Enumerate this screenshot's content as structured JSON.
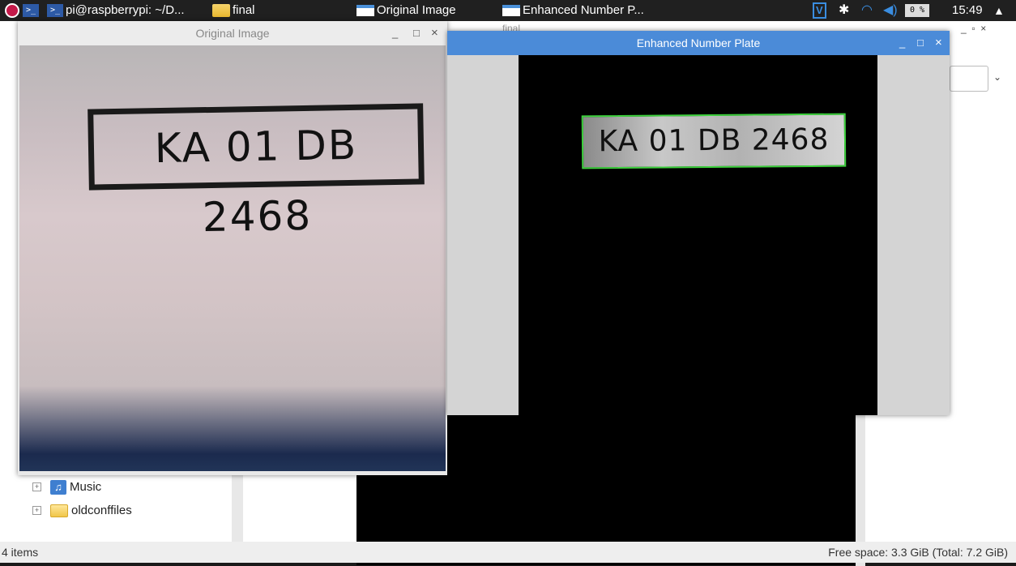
{
  "taskbar": {
    "terminal_task": "pi@raspberrypi: ~/D...",
    "folder_task": "final",
    "original_task": "Original Image",
    "enhanced_task": "Enhanced Number P...",
    "cpu": "0 %",
    "clock": "15:49"
  },
  "file_manager": {
    "title": "final",
    "tree": [
      "Music",
      "oldconffiles"
    ],
    "status_left": "4 items",
    "status_right": "Free space: 3.3 GiB (Total: 7.2 GiB)"
  },
  "original_window": {
    "title": "Original Image",
    "plate_text": "KA 01 DB 2468"
  },
  "enhanced_window": {
    "title": "Enhanced Number Plate",
    "plate_text": "KA 01 DB 2468"
  },
  "window_controls": {
    "minimize": "_",
    "maximize": "□",
    "close": "×"
  }
}
